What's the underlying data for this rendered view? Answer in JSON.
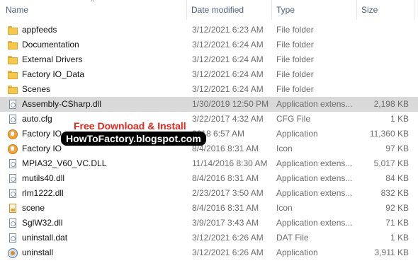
{
  "columns": {
    "name": "Name",
    "date": "Date modified",
    "type": "Type",
    "size": "Size"
  },
  "files": [
    {
      "name": "appfeeds",
      "date": "3/12/2021 6:23 AM",
      "type": "File folder",
      "size": "",
      "icon": "folder-icon"
    },
    {
      "name": "Documentation",
      "date": "3/12/2021 6:24 AM",
      "type": "File folder",
      "size": "",
      "icon": "folder-icon"
    },
    {
      "name": "External Drivers",
      "date": "3/12/2021 6:24 AM",
      "type": "File folder",
      "size": "",
      "icon": "folder-icon"
    },
    {
      "name": "Factory IO_Data",
      "date": "3/12/2021 6:24 AM",
      "type": "File folder",
      "size": "",
      "icon": "folder-icon"
    },
    {
      "name": "Scenes",
      "date": "3/12/2021 6:24 AM",
      "type": "File folder",
      "size": "",
      "icon": "folder-icon"
    },
    {
      "name": "Assembly-CSharp.dll",
      "date": "1/30/2019 12:50 PM",
      "type": "Application extens...",
      "size": "2,198 KB",
      "icon": "dll-file-icon",
      "selected": true
    },
    {
      "name": "auto.cfg",
      "date": "3/22/2017 4:32 AM",
      "type": "CFG File",
      "size": "1 KB",
      "icon": "cfg-file-icon"
    },
    {
      "name": "Factory IO",
      "date": "2018 6:57 AM",
      "type": "Application",
      "size": "11,360 KB",
      "icon": "app-icon"
    },
    {
      "name": "Factory IO",
      "date": "8/4/2016 8:31 AM",
      "type": "Icon",
      "size": "97 KB",
      "icon": "app-icon"
    },
    {
      "name": "MPIA32_V60_VC.DLL",
      "date": "11/14/2016 8:30 AM",
      "type": "Application extens...",
      "size": "5,017 KB",
      "icon": "dll-file-icon"
    },
    {
      "name": "mutils40.dll",
      "date": "8/4/2016 8:31 AM",
      "type": "Application extens...",
      "size": "84 KB",
      "icon": "dll-file-icon"
    },
    {
      "name": "rlm1222.dll",
      "date": "2/23/2017 3:50 AM",
      "type": "Application extens...",
      "size": "832 KB",
      "icon": "dll-file-icon"
    },
    {
      "name": "scene",
      "date": "8/4/2016 8:31 AM",
      "type": "Icon",
      "size": "92 KB",
      "icon": "image-file-icon"
    },
    {
      "name": "SglW32.dll",
      "date": "3/9/2017 3:43 AM",
      "type": "Application extens...",
      "size": "71 KB",
      "icon": "dll-file-icon"
    },
    {
      "name": "uninstall.dat",
      "date": "3/12/2021 6:26 AM",
      "type": "DAT File",
      "size": "1 KB",
      "icon": "dat-file-icon"
    },
    {
      "name": "uninstall",
      "date": "3/12/2021 6:26 AM",
      "type": "Application",
      "size": "3,911 KB",
      "icon": "uninstall-icon"
    }
  ],
  "watermark": {
    "line1": "Free Download & Install",
    "line2": "HowToFactory.blogspot.com"
  },
  "colors": {
    "selected_row": "#d9d9d9",
    "header_text": "#4c607a",
    "watermark_red": "#e1261c"
  }
}
